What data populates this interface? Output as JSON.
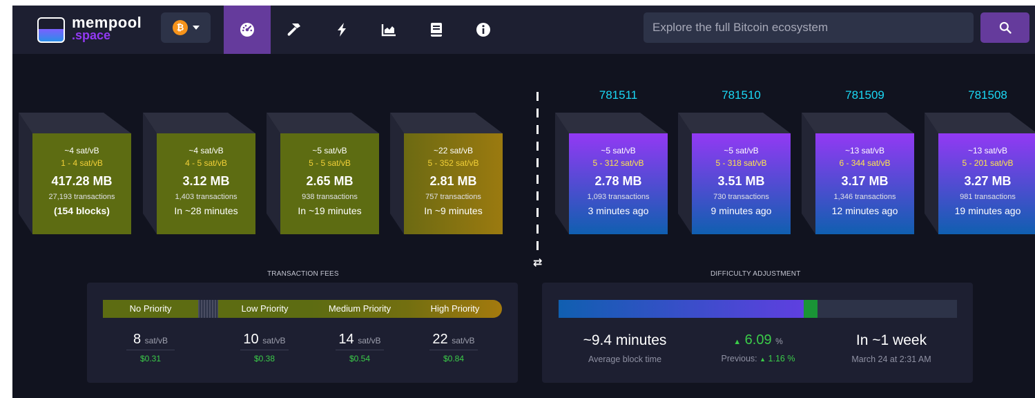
{
  "nav": {
    "logo_name": "mempool",
    "logo_sub": ".space",
    "network_icon": "bitcoin-icon",
    "network_symbol": "₿",
    "items": [
      "dashboard-icon",
      "mining-hammer-icon",
      "lightning-icon",
      "graphs-icon",
      "docs-book-icon",
      "about-info-icon"
    ],
    "search_placeholder": "Explore the full Bitcoin ecosystem",
    "search_icon": "search-icon"
  },
  "pending_blocks": [
    {
      "fee": "~4 sat/vB",
      "range": "1 - 4 sat/vB",
      "size": "417.28 MB",
      "tx": "27,193 transactions",
      "when": "(154 blocks)"
    },
    {
      "fee": "~4 sat/vB",
      "range": "4 - 5 sat/vB",
      "size": "3.12 MB",
      "tx": "1,403 transactions",
      "when": "In ~28 minutes"
    },
    {
      "fee": "~5 sat/vB",
      "range": "5 - 5 sat/vB",
      "size": "2.65 MB",
      "tx": "938 transactions",
      "when": "In ~19 minutes"
    },
    {
      "fee": "~22 sat/vB",
      "range": "5 - 352 sat/vB",
      "size": "2.81 MB",
      "tx": "757 transactions",
      "when": "In ~9 minutes"
    }
  ],
  "mined_blocks": [
    {
      "height": "781511",
      "fee": "~5 sat/vB",
      "range": "5 - 312 sat/vB",
      "size": "2.78 MB",
      "tx": "1,093 transactions",
      "when": "3 minutes ago"
    },
    {
      "height": "781510",
      "fee": "~5 sat/vB",
      "range": "5 - 318 sat/vB",
      "size": "3.51 MB",
      "tx": "730 transactions",
      "when": "9 minutes ago"
    },
    {
      "height": "781509",
      "fee": "~13 sat/vB",
      "range": "6 - 344 sat/vB",
      "size": "3.17 MB",
      "tx": "1,346 transactions",
      "when": "12 minutes ago"
    },
    {
      "height": "781508",
      "fee": "~13 sat/vB",
      "range": "5 - 201 sat/vB",
      "size": "3.27 MB",
      "tx": "981 transactions",
      "when": "19 minutes ago"
    }
  ],
  "swap_symbol": "⇄",
  "fees": {
    "title": "TRANSACTION FEES",
    "labels": [
      "No Priority",
      "Low Priority",
      "Medium Priority",
      "High Priority"
    ],
    "rates": [
      {
        "value": "8",
        "unit": "sat/vB",
        "usd": "$0.31"
      },
      {
        "value": "10",
        "unit": "sat/vB",
        "usd": "$0.38"
      },
      {
        "value": "14",
        "unit": "sat/vB",
        "usd": "$0.54"
      },
      {
        "value": "22",
        "unit": "sat/vB",
        "usd": "$0.84"
      }
    ]
  },
  "difficulty": {
    "title": "DIFFICULTY ADJUSTMENT",
    "progress": 0.65,
    "avg_time": "~9.4 minutes",
    "avg_time_label": "Average block time",
    "change": "6.09",
    "change_unit": "%",
    "previous_label": "Previous:",
    "previous_value": "1.16 %",
    "eta": "In ~1 week",
    "eta_date": "March 24 at 2:31 AM",
    "colors": {
      "fill_start": "#105fb0",
      "fill_end": "#5f3fe0",
      "marker": "#1a9436",
      "positive": "#3bcc49"
    }
  }
}
